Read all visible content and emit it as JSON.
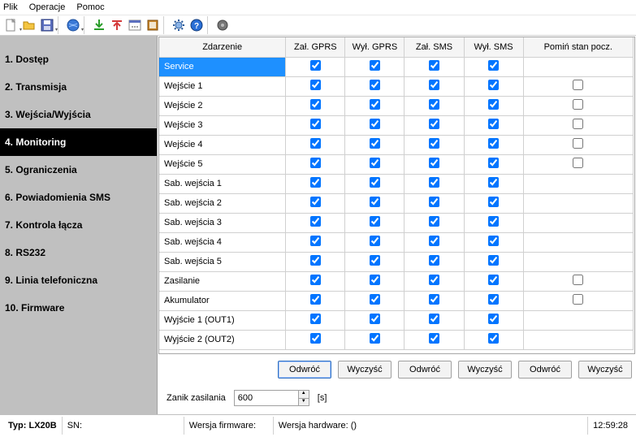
{
  "menu": [
    "Plik",
    "Operacje",
    "Pomoc"
  ],
  "sidebar": {
    "items": [
      {
        "label": "1. Dostęp"
      },
      {
        "label": "2. Transmisja"
      },
      {
        "label": "3. Wejścia/Wyjścia"
      },
      {
        "label": "4. Monitoring"
      },
      {
        "label": "5. Ograniczenia"
      },
      {
        "label": "6. Powiadomienia SMS"
      },
      {
        "label": "7. Kontrola łącza"
      },
      {
        "label": "8. RS232"
      },
      {
        "label": "9. Linia telefoniczna"
      },
      {
        "label": "10. Firmware"
      }
    ],
    "active_index": 3
  },
  "table": {
    "headers": [
      "Zdarzenie",
      "Zał. GPRS",
      "Wył. GPRS",
      "Zał. SMS",
      "Wył. SMS",
      "Pomiń stan pocz."
    ],
    "rows": [
      {
        "name": "Service",
        "c1": true,
        "c2": true,
        "c3": true,
        "c4": true,
        "omit_applicable": false,
        "selected": true
      },
      {
        "name": "Wejście 1",
        "c1": true,
        "c2": true,
        "c3": true,
        "c4": true,
        "omit_applicable": true,
        "omit": false
      },
      {
        "name": "Wejście 2",
        "c1": true,
        "c2": true,
        "c3": true,
        "c4": true,
        "omit_applicable": true,
        "omit": false
      },
      {
        "name": "Wejście 3",
        "c1": true,
        "c2": true,
        "c3": true,
        "c4": true,
        "omit_applicable": true,
        "omit": false
      },
      {
        "name": "Wejście 4",
        "c1": true,
        "c2": true,
        "c3": true,
        "c4": true,
        "omit_applicable": true,
        "omit": false
      },
      {
        "name": "Wejście 5",
        "c1": true,
        "c2": true,
        "c3": true,
        "c4": true,
        "omit_applicable": true,
        "omit": false
      },
      {
        "name": "Sab. wejścia 1",
        "c1": true,
        "c2": true,
        "c3": true,
        "c4": true,
        "omit_applicable": false
      },
      {
        "name": "Sab. wejścia 2",
        "c1": true,
        "c2": true,
        "c3": true,
        "c4": true,
        "omit_applicable": false
      },
      {
        "name": "Sab. wejścia 3",
        "c1": true,
        "c2": true,
        "c3": true,
        "c4": true,
        "omit_applicable": false
      },
      {
        "name": "Sab. wejścia 4",
        "c1": true,
        "c2": true,
        "c3": true,
        "c4": true,
        "omit_applicable": false
      },
      {
        "name": "Sab. wejścia 5",
        "c1": true,
        "c2": true,
        "c3": true,
        "c4": true,
        "omit_applicable": false
      },
      {
        "name": "Zasilanie",
        "c1": true,
        "c2": true,
        "c3": true,
        "c4": true,
        "omit_applicable": true,
        "omit": false
      },
      {
        "name": "Akumulator",
        "c1": true,
        "c2": true,
        "c3": true,
        "c4": true,
        "omit_applicable": true,
        "omit": false
      },
      {
        "name": "Wyjście 1 (OUT1)",
        "c1": true,
        "c2": true,
        "c3": true,
        "c4": true,
        "omit_applicable": false
      },
      {
        "name": "Wyjście 2 (OUT2)",
        "c1": true,
        "c2": true,
        "c3": true,
        "c4": true,
        "omit_applicable": false
      }
    ]
  },
  "buttons": {
    "invert": "Odwróć",
    "clear": "Wyczyść"
  },
  "params": {
    "power_loss_label": "Zanik zasilania",
    "power_loss_value": "600",
    "power_loss_unit": "[s]"
  },
  "status": {
    "type_label": "Typ:",
    "type_value": "LX20B",
    "sn_label": "SN:",
    "firmware_label": "Wersja firmware:",
    "hardware_label": "Wersja hardware: ()",
    "clock": "12:59:28"
  }
}
